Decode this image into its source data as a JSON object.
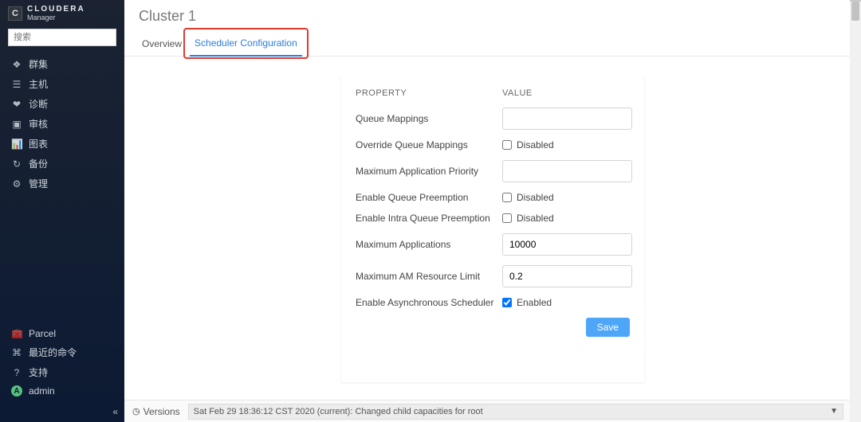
{
  "brand": {
    "badge": "C",
    "line1": "CLOUDERA",
    "line2": "Manager"
  },
  "search": {
    "placeholder": "搜索"
  },
  "sidebar": {
    "items": [
      {
        "icon": "❖",
        "label": "群集"
      },
      {
        "icon": "☰",
        "label": "主机"
      },
      {
        "icon": "❤",
        "label": "诊断"
      },
      {
        "icon": "▣",
        "label": "审核"
      },
      {
        "icon": "📊",
        "label": "图表"
      },
      {
        "icon": "↻",
        "label": "备份"
      },
      {
        "icon": "⚙",
        "label": "管理"
      }
    ],
    "bottom": [
      {
        "icon": "🧰",
        "label": "Parcel"
      },
      {
        "icon": "⌘",
        "label": "最近的命令"
      },
      {
        "icon": "?",
        "label": "支持"
      }
    ],
    "user": {
      "initial": "A",
      "name": "admin"
    },
    "collapse": "«"
  },
  "header": {
    "title": "Cluster 1"
  },
  "tabs": {
    "overview": "Overview",
    "scheduler": "Scheduler Configuration"
  },
  "panel": {
    "heads": {
      "property": "PROPERTY",
      "value": "VALUE"
    },
    "queueMappingsLabel": "Queue Mappings",
    "queueMappings": "",
    "overrideQueueLabel": "Override Queue Mappings",
    "overrideQueueStatus": "Disabled",
    "maxAppPriorityLabel": "Maximum Application Priority",
    "maxAppPriority": "",
    "enableQueuePreemptionLabel": "Enable Queue Preemption",
    "enableQueuePreemptionStatus": "Disabled",
    "enableIntraQueueLabel": "Enable Intra Queue Preemption",
    "enableIntraQueueStatus": "Disabled",
    "maxAppsLabel": "Maximum Applications",
    "maxApps": "10000",
    "maxAmLimitLabel": "Maximum AM Resource Limit",
    "maxAmLimit": "0.2",
    "asyncSchedulerLabel": "Enable Asynchronous Scheduler",
    "asyncSchedulerStatus": "Enabled",
    "save": "Save"
  },
  "footer": {
    "versionsLabel": "Versions",
    "current": "Sat Feb 29 18:36:12 CST 2020 (current): Changed child capacities for root",
    "caret": "▼"
  }
}
